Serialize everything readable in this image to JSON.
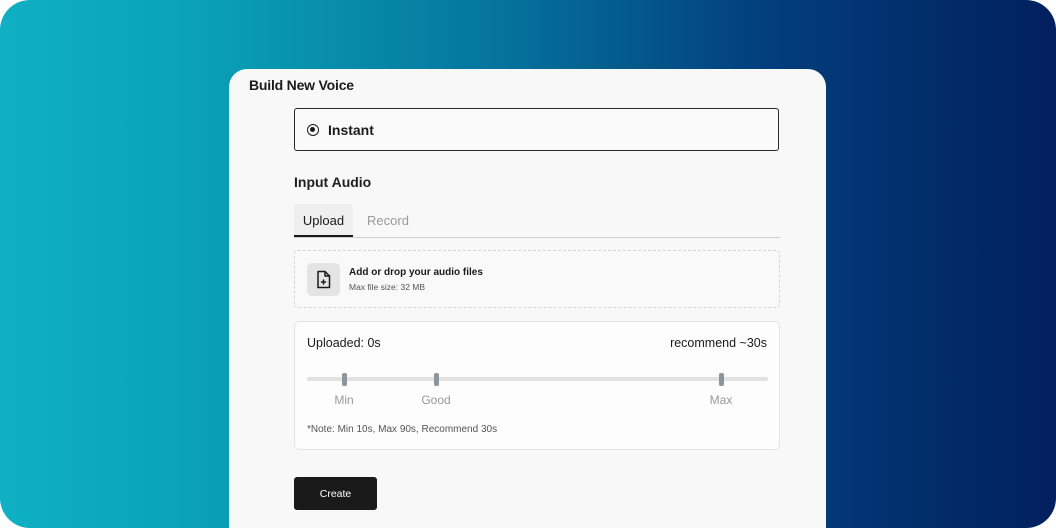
{
  "panel": {
    "title": "Build New Voice"
  },
  "mode": {
    "label": "Instant",
    "selected": true
  },
  "input_audio": {
    "title": "Input Audio",
    "tabs": [
      {
        "label": "Upload",
        "active": true
      },
      {
        "label": "Record",
        "active": false
      }
    ]
  },
  "dropzone": {
    "icon": "file-add-icon",
    "title": "Add or drop your audio files",
    "subtitle": "Max file size: 32 MB"
  },
  "progress": {
    "uploaded_label": "Uploaded: 0s",
    "recommend_label": "recommend ~30s",
    "max_seconds": 90,
    "markers": [
      {
        "label": "Min",
        "seconds": 10
      },
      {
        "label": "Good",
        "seconds": 30
      },
      {
        "label": "Max",
        "seconds": 90
      }
    ],
    "note": "*Note: Min 10s, Max 90s, Recommend 30s"
  },
  "actions": {
    "create_label": "Create"
  },
  "colors": {
    "accent": "#1a1a1a",
    "marker": "#8c949c",
    "track": "#e2e2e2",
    "background_start": "#0fb0c4",
    "background_end": "#021f5e"
  }
}
